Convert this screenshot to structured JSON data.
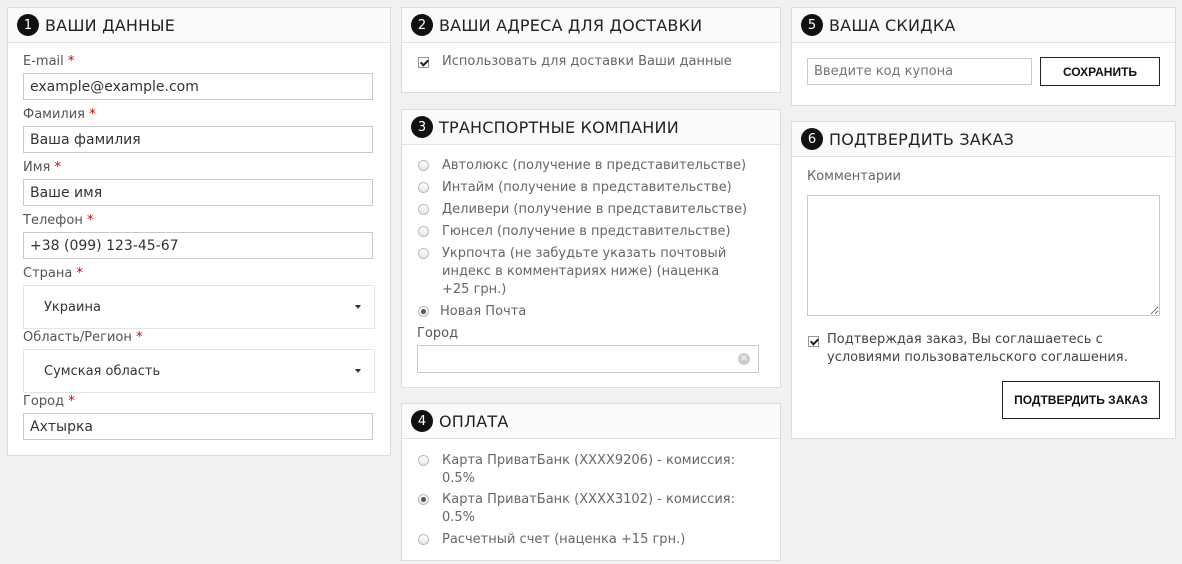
{
  "personal": {
    "step": "1",
    "title": "ВАШИ ДАННЫЕ",
    "required_mark": "*",
    "email": {
      "label": "E-mail",
      "value": "example@example.com"
    },
    "surname": {
      "label": "Фамилия",
      "value": "Ваша фамилия"
    },
    "name": {
      "label": "Имя",
      "value": "Ваше имя"
    },
    "phone": {
      "label": "Телефон",
      "value": "+38 (099) 123-45-67"
    },
    "country": {
      "label": "Страна",
      "value": "Украина"
    },
    "region": {
      "label": "Область/Регион",
      "value": "Сумская область"
    },
    "city": {
      "label": "Город",
      "value": "Ахтырка"
    }
  },
  "addresses": {
    "step": "2",
    "title": "ВАШИ АДРЕСА ДЛЯ ДОСТАВКИ",
    "use_data_label": "Использовать для доставки Ваши данные",
    "use_data_checked": true
  },
  "shipping": {
    "step": "3",
    "title": "ТРАНСПОРТНЫЕ КОМПАНИИ",
    "options": [
      {
        "label": "Автолюкс (получение в представительстве)",
        "selected": false
      },
      {
        "label": "Интайм (получение в представительстве)",
        "selected": false
      },
      {
        "label": "Деливери (получение в представительстве)",
        "selected": false
      },
      {
        "label": "Гюнсел (получение в представительстве)",
        "selected": false
      },
      {
        "label": "Укрпочта (не забудьте указать почтовый индекс в комментариях ниже)  (наценка +25 грн.)",
        "selected": false
      },
      {
        "label": "Новая Почта",
        "selected": true
      }
    ],
    "city_label": "Город",
    "city_value": ""
  },
  "payment": {
    "step": "4",
    "title": "ОПЛАТА",
    "options": [
      {
        "label": "Карта ПриватБанк (XXXX9206) - комиссия: 0.5%",
        "selected": false
      },
      {
        "label": "Карта ПриватБанк (XXXX3102) - комиссия: 0.5%",
        "selected": true
      },
      {
        "label": "Расчетный счет  (наценка +15 грн.)",
        "selected": false
      }
    ]
  },
  "discount": {
    "step": "5",
    "title": "ВАША СКИДКА",
    "coupon_placeholder": "Введите код купона",
    "save_label": "СОХРАНИТЬ"
  },
  "confirm": {
    "step": "6",
    "title": "ПОДТВЕРДИТЬ ЗАКАЗ",
    "comment_label": "Комментарии",
    "comment_value": "",
    "agree_label": "Подтверждая заказ, Вы соглашаетесь с условиями пользовательского соглашения.",
    "agree_checked": true,
    "confirm_label": "ПОДТВЕРДИТЬ ЗАКАЗ"
  }
}
